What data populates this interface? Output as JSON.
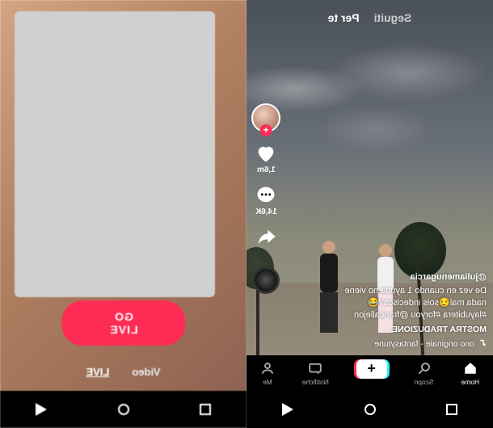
{
  "left": {
    "go_live_label": "GO LIVE",
    "modes": {
      "video": "Video",
      "live": "LIVE"
    }
  },
  "right": {
    "tabs": {
      "following": "Seguiti",
      "for_you": "Per te"
    },
    "actions": {
      "like_count": "1,6m",
      "comment_count": "14,6K"
    },
    "caption": {
      "username": "@juliamenugarcia",
      "line1": "De vez en cuando 1 ayuda no viene",
      "line2": "nada mal😏sois indecisos?😂",
      "line3": "#layubitera #foryou @francallejon",
      "translate": "MOSTRA TRADUZIONE",
      "sound": "ono originale - fantasytune"
    },
    "nav": {
      "home": "Home",
      "discover": "Scopri",
      "inbox": "Notifiche",
      "me": "Me"
    }
  }
}
